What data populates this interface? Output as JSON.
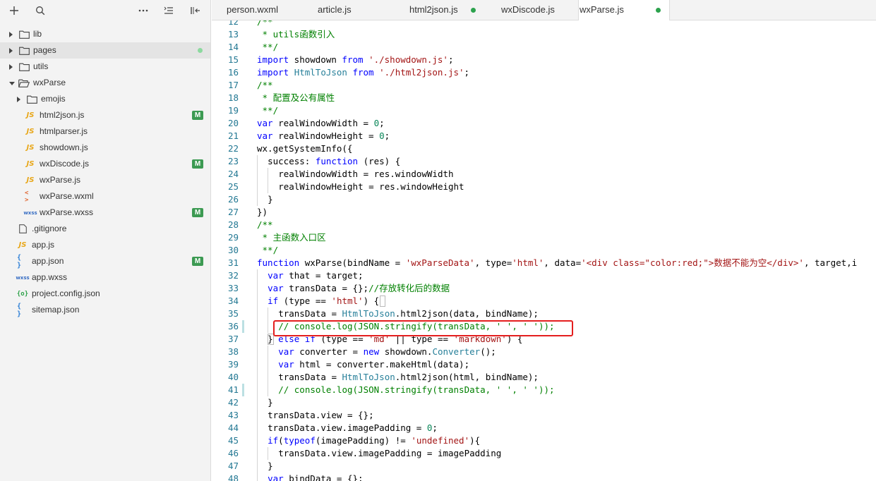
{
  "toolbar": {
    "add_icon": "plus-icon",
    "search_icon": "search-icon",
    "more_icon": "more-icon",
    "sort_icon": "sort-icon",
    "collapse_icon": "collapse-sidebar-icon"
  },
  "sidebar": {
    "items": [
      {
        "label": "lib",
        "type": "folder",
        "depth": 0,
        "expanded": false
      },
      {
        "label": "pages",
        "type": "folder",
        "depth": 0,
        "expanded": false,
        "selected": true,
        "modified_dot": true
      },
      {
        "label": "utils",
        "type": "folder",
        "depth": 0,
        "expanded": false
      },
      {
        "label": "wxParse",
        "type": "folder-open",
        "depth": 0,
        "expanded": true
      },
      {
        "label": "emojis",
        "type": "folder",
        "depth": 1,
        "expanded": false
      },
      {
        "label": "html2json.js",
        "type": "js",
        "depth": 1,
        "badge": "M"
      },
      {
        "label": "htmlparser.js",
        "type": "js",
        "depth": 1
      },
      {
        "label": "showdown.js",
        "type": "js",
        "depth": 1
      },
      {
        "label": "wxDiscode.js",
        "type": "js",
        "depth": 1,
        "badge": "M"
      },
      {
        "label": "wxParse.js",
        "type": "js",
        "depth": 1
      },
      {
        "label": "wxParse.wxml",
        "type": "wxml",
        "depth": 1
      },
      {
        "label": "wxParse.wxss",
        "type": "wxss",
        "depth": 1,
        "badge": "M"
      },
      {
        "label": ".gitignore",
        "type": "file",
        "depth": 0
      },
      {
        "label": "app.js",
        "type": "js",
        "depth": 0
      },
      {
        "label": "app.json",
        "type": "json",
        "depth": 0,
        "badge": "M"
      },
      {
        "label": "app.wxss",
        "type": "wxss",
        "depth": 0
      },
      {
        "label": "project.config.json",
        "type": "config",
        "depth": 0
      },
      {
        "label": "sitemap.json",
        "type": "json",
        "depth": 0
      }
    ]
  },
  "tabs": [
    {
      "label": "person.wxml",
      "active": false,
      "dot": false
    },
    {
      "label": "article.js",
      "active": false,
      "dot": false
    },
    {
      "label": "html2json.js",
      "active": false,
      "dot": true
    },
    {
      "label": "wxDiscode.js",
      "active": false,
      "dot": false
    },
    {
      "label": "wxParse.js",
      "active": true,
      "dot": true
    }
  ],
  "colors": {
    "comment": "#008000",
    "keyword": "#0000ff",
    "string": "#a31515",
    "type": "#267f99",
    "number": "#098658",
    "line_number": "#237893",
    "highlight_box": "#e41e1e",
    "badge": "#3c9a52",
    "dot": "#2ca24d"
  },
  "editor": {
    "lines": [
      {
        "n": "12",
        "indent": 0,
        "tokens": [
          [
            "comment",
            "/**"
          ]
        ]
      },
      {
        "n": "13",
        "indent": 0,
        "tokens": [
          [
            "comment",
            " * utils函数引入"
          ]
        ]
      },
      {
        "n": "14",
        "indent": 0,
        "tokens": [
          [
            "comment",
            " **/"
          ]
        ]
      },
      {
        "n": "15",
        "indent": 0,
        "tokens": [
          [
            "keyword",
            "import"
          ],
          [
            "plain",
            " showdown "
          ],
          [
            "keyword",
            "from"
          ],
          [
            "plain",
            " "
          ],
          [
            "string",
            "'./showdown.js'"
          ],
          [
            "plain",
            ";"
          ]
        ]
      },
      {
        "n": "16",
        "indent": 0,
        "tokens": [
          [
            "keyword",
            "import"
          ],
          [
            "plain",
            " "
          ],
          [
            "type",
            "HtmlToJson"
          ],
          [
            "plain",
            " "
          ],
          [
            "keyword",
            "from"
          ],
          [
            "plain",
            " "
          ],
          [
            "string",
            "'./html2json.js'"
          ],
          [
            "plain",
            ";"
          ]
        ]
      },
      {
        "n": "17",
        "indent": 0,
        "tokens": [
          [
            "comment",
            "/**"
          ]
        ]
      },
      {
        "n": "18",
        "indent": 0,
        "tokens": [
          [
            "comment",
            " * 配置及公有属性"
          ]
        ]
      },
      {
        "n": "19",
        "indent": 0,
        "tokens": [
          [
            "comment",
            " **/"
          ]
        ]
      },
      {
        "n": "20",
        "indent": 0,
        "tokens": [
          [
            "keyword",
            "var"
          ],
          [
            "plain",
            " realWindowWidth = "
          ],
          [
            "number",
            "0"
          ],
          [
            "plain",
            ";"
          ]
        ]
      },
      {
        "n": "21",
        "indent": 0,
        "tokens": [
          [
            "keyword",
            "var"
          ],
          [
            "plain",
            " realWindowHeight = "
          ],
          [
            "number",
            "0"
          ],
          [
            "plain",
            ";"
          ]
        ]
      },
      {
        "n": "22",
        "indent": 0,
        "tokens": [
          [
            "plain",
            "wx.getSystemInfo({"
          ]
        ]
      },
      {
        "n": "23",
        "indent": 1,
        "tokens": [
          [
            "plain",
            "success: "
          ],
          [
            "keyword",
            "function"
          ],
          [
            "plain",
            " (res) {"
          ]
        ]
      },
      {
        "n": "24",
        "indent": 2,
        "tokens": [
          [
            "plain",
            "realWindowWidth = res.windowWidth"
          ]
        ]
      },
      {
        "n": "25",
        "indent": 2,
        "tokens": [
          [
            "plain",
            "realWindowHeight = res.windowHeight"
          ]
        ]
      },
      {
        "n": "26",
        "indent": 1,
        "tokens": [
          [
            "plain",
            "}"
          ]
        ]
      },
      {
        "n": "27",
        "indent": 0,
        "tokens": [
          [
            "plain",
            "})"
          ]
        ]
      },
      {
        "n": "28",
        "indent": 0,
        "tokens": [
          [
            "comment",
            "/**"
          ]
        ]
      },
      {
        "n": "29",
        "indent": 0,
        "tokens": [
          [
            "comment",
            " * 主函数入口区"
          ]
        ]
      },
      {
        "n": "30",
        "indent": 0,
        "tokens": [
          [
            "comment",
            " **/"
          ]
        ]
      },
      {
        "n": "31",
        "indent": 0,
        "tokens": [
          [
            "keyword",
            "function"
          ],
          [
            "plain",
            " wxParse(bindName = "
          ],
          [
            "string",
            "'wxParseData'"
          ],
          [
            "plain",
            ", type="
          ],
          [
            "string",
            "'html'"
          ],
          [
            "plain",
            ", data="
          ],
          [
            "string",
            "'<div class=\"color:red;\">数据不能为空</div>'"
          ],
          [
            "plain",
            ", target,i"
          ]
        ]
      },
      {
        "n": "32",
        "indent": 1,
        "tokens": [
          [
            "keyword",
            "var"
          ],
          [
            "plain",
            " that = target;"
          ]
        ]
      },
      {
        "n": "33",
        "indent": 1,
        "tokens": [
          [
            "keyword",
            "var"
          ],
          [
            "plain",
            " transData = {};"
          ],
          [
            "comment",
            "//存放转化后的数据"
          ]
        ]
      },
      {
        "n": "34",
        "indent": 1,
        "tokens": [
          [
            "keyword",
            "if"
          ],
          [
            "plain",
            " (type == "
          ],
          [
            "string",
            "'html'"
          ],
          [
            "plain",
            ") {"
          ]
        ]
      },
      {
        "n": "35",
        "indent": 2,
        "tokens": [
          [
            "plain",
            "transData = "
          ],
          [
            "type",
            "HtmlToJson"
          ],
          [
            "plain",
            ".html2json(data, bindName);"
          ]
        ]
      },
      {
        "n": "36",
        "indent": 2,
        "marker": true,
        "tokens": [
          [
            "comment",
            "// console.log(JSON.stringify(transData, ' ', ' '));"
          ]
        ]
      },
      {
        "n": "37",
        "indent": 1,
        "tokens": [
          [
            "plain",
            "} "
          ],
          [
            "keyword",
            "else"
          ],
          [
            "plain",
            " "
          ],
          [
            "keyword",
            "if"
          ],
          [
            "plain",
            " (type == "
          ],
          [
            "string",
            "'md'"
          ],
          [
            "plain",
            " || type == "
          ],
          [
            "string",
            "'markdown'"
          ],
          [
            "plain",
            ") {"
          ]
        ]
      },
      {
        "n": "38",
        "indent": 2,
        "tokens": [
          [
            "keyword",
            "var"
          ],
          [
            "plain",
            " converter = "
          ],
          [
            "keyword",
            "new"
          ],
          [
            "plain",
            " showdown."
          ],
          [
            "type",
            "Converter"
          ],
          [
            "plain",
            "();"
          ]
        ]
      },
      {
        "n": "39",
        "indent": 2,
        "tokens": [
          [
            "keyword",
            "var"
          ],
          [
            "plain",
            " html = converter.makeHtml(data);"
          ]
        ]
      },
      {
        "n": "40",
        "indent": 2,
        "tokens": [
          [
            "plain",
            "transData = "
          ],
          [
            "type",
            "HtmlToJson"
          ],
          [
            "plain",
            ".html2json(html, bindName);"
          ]
        ]
      },
      {
        "n": "41",
        "indent": 2,
        "marker": true,
        "tokens": [
          [
            "comment",
            "// console.log(JSON.stringify(transData, ' ', ' '));"
          ]
        ]
      },
      {
        "n": "42",
        "indent": 1,
        "tokens": [
          [
            "plain",
            "}"
          ]
        ]
      },
      {
        "n": "43",
        "indent": 1,
        "tokens": [
          [
            "plain",
            "transData.view = {};"
          ]
        ]
      },
      {
        "n": "44",
        "indent": 1,
        "tokens": [
          [
            "plain",
            "transData.view.imagePadding = "
          ],
          [
            "number",
            "0"
          ],
          [
            "plain",
            ";"
          ]
        ]
      },
      {
        "n": "45",
        "indent": 1,
        "tokens": [
          [
            "keyword",
            "if"
          ],
          [
            "plain",
            "("
          ],
          [
            "keyword",
            "typeof"
          ],
          [
            "plain",
            "(imagePadding) != "
          ],
          [
            "string",
            "'undefined'"
          ],
          [
            "plain",
            "){"
          ]
        ]
      },
      {
        "n": "46",
        "indent": 2,
        "tokens": [
          [
            "plain",
            "transData.view.imagePadding = imagePadding"
          ]
        ]
      },
      {
        "n": "47",
        "indent": 1,
        "tokens": [
          [
            "plain",
            "}"
          ]
        ]
      },
      {
        "n": "48",
        "indent": 1,
        "tokens": [
          [
            "keyword",
            "var"
          ],
          [
            "plain",
            " bindData = {};"
          ]
        ]
      }
    ]
  }
}
